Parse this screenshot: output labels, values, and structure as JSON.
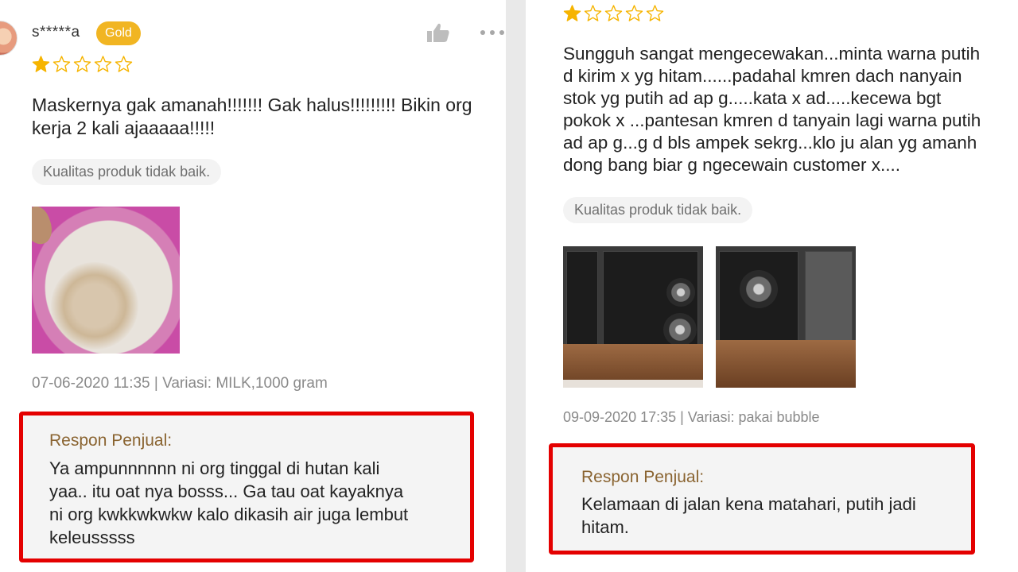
{
  "left_review": {
    "username": "s*****a",
    "badge": "Gold",
    "rating": 1,
    "max_rating": 5,
    "text": "Maskernya gak amanah!!!!!!!  Gak halus!!!!!!!!! Bikin org\nkerja 2 kali ajaaaaa!!!!!",
    "tag": "Kualitas produk tidak baik.",
    "meta": "07-06-2020 11:35 | Variasi: MILK,1000 gram",
    "seller_response": {
      "title": "Respon Penjual:",
      "lines": [
        "Ya ampunnnnnn ni org tinggal di hutan kali",
        "yaa.. itu oat nya bosss... Ga tau oat kayaknya",
        "ni org kwkkwkwkw kalo dikasih air juga lembut",
        "keleusssss"
      ]
    }
  },
  "right_review": {
    "rating": 1,
    "max_rating": 5,
    "text": "Sungguh sangat mengecewakan...minta warna putih\nd kirim x yg hitam......padahal kmren dach nanyain\nstok yg putih ad ap g.....kata x ad.....kecewa bgt\npokok x ...pantesan kmren d tanyain lagi warna putih\nad ap g...g d bls ampek sekrg...klo ju alan yg amanh\ndong bang biar g ngecewain customer x....",
    "tag": "Kualitas produk tidak baik.",
    "meta": "09-09-2020 17:35 | Variasi: pakai bubble",
    "seller_response": {
      "title": "Respon Penjual:",
      "lines": [
        "Kelamaan di jalan kena matahari, putih jadi",
        "hitam."
      ]
    }
  },
  "icons": {
    "like": "thumbs-up-icon",
    "more": "more-dots-icon",
    "star": "star-icon"
  },
  "colors": {
    "star_filled": "#f6b400",
    "badge_gold": "#f1b522",
    "highlight_border": "#e40000",
    "seller_title": "#8a6431"
  }
}
